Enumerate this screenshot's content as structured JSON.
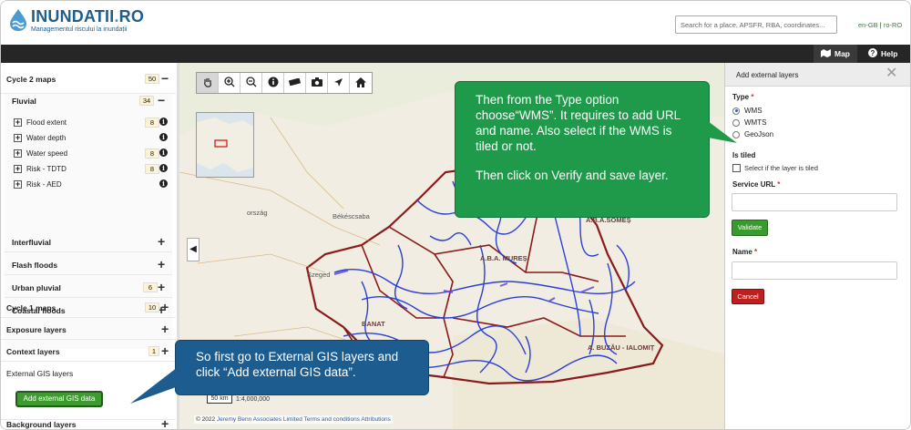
{
  "header": {
    "logo_title": "INUNDATII",
    "logo_dot": ".",
    "logo_suffix": "RO",
    "logo_subtitle": "Managementul riscului la inundații",
    "search_placeholder": "Search for a place, APSFR, RBA, coordinates...",
    "lang_en": "en-GB",
    "lang_sep": "|",
    "lang_ro": "ro-RO"
  },
  "nav": {
    "map_label": "Map",
    "help_label": "Help"
  },
  "sidebar": {
    "cycle2": {
      "label": "Cycle 2 maps",
      "count": "50"
    },
    "fluvial": {
      "label": "Fluvial",
      "count": "34"
    },
    "fluvial_items": [
      {
        "label": "Flood extent",
        "badge": "8"
      },
      {
        "label": "Water depth",
        "badge": ""
      },
      {
        "label": "Water speed",
        "badge": "8"
      },
      {
        "label": "Risk - TDTD",
        "badge": "8"
      },
      {
        "label": "Risk - AED",
        "badge": ""
      }
    ],
    "interfluvial": {
      "label": "Interfluvial"
    },
    "flash_floods": {
      "label": "Flash floods",
      "count": ""
    },
    "urban_pluvial": {
      "label": "Urban pluvial",
      "count": "6"
    },
    "coastal_floods": {
      "label": "Coastal floods"
    },
    "cycle1": {
      "label": "Cycle 1 maps",
      "count": "10"
    },
    "exposure": {
      "label": "Exposure layers"
    },
    "context": {
      "label": "Context layers",
      "count": "1"
    },
    "external": {
      "label": "External GIS layers"
    },
    "add_external_btn": "Add external GIS data",
    "background": {
      "label": "Background layers"
    }
  },
  "map": {
    "tools": [
      "pan-icon",
      "zoom-in-icon",
      "zoom-out-icon",
      "info-icon",
      "measure-icon",
      "camera-icon",
      "locate-icon",
      "home-icon"
    ],
    "scale_label": "50 km",
    "scale_ratio": "1:4,000,000",
    "attribution_prefix": "© 2022",
    "attribution_author": "Jeremy Benn Associates Limited",
    "attribution_terms": "Terms and conditions",
    "attribution_link": "Attributions",
    "place_labels": {
      "orszag": "ország",
      "bekescsaba": "Békéscsaba",
      "szeged": "Szeged",
      "banat": "BANAT",
      "buzau": "A. BUZĂU - IALOMIȚ",
      "somes": "A.B.A.SOMEȘ",
      "mures": "A.B.A. MUREȘ"
    },
    "collapse_symbol": "◀"
  },
  "callouts": {
    "green_line1": "Then from the Type option choose“WMS”. It requires to add URL and name. Also select if the WMS is tiled or not.",
    "green_line2": "Then click on Verify and save layer.",
    "blue": "So first go to External GIS layers and click “Add external GIS data”."
  },
  "panel": {
    "title": "Add external layers",
    "close": "✕",
    "type_label": "Type",
    "type_options": [
      "WMS",
      "WMTS",
      "GeoJson"
    ],
    "type_selected": "WMS",
    "is_tiled_label": "Is tiled",
    "tiled_checkbox_label": "Select if the layer is tiled",
    "url_label": "Service URL",
    "validate_btn": "Validate",
    "name_label": "Name",
    "cancel_btn": "Cancel",
    "required_mark": "*"
  },
  "colors": {
    "logo_blue": "#1f5d8c",
    "navbar": "#262626",
    "green_callout": "#1e9a4a",
    "blue_callout": "#1d5c8e",
    "add_button": "#3e9b2f",
    "cancel_button": "#c01f1f",
    "river": "#2a3fd6",
    "boundary": "#9a1f1f"
  }
}
